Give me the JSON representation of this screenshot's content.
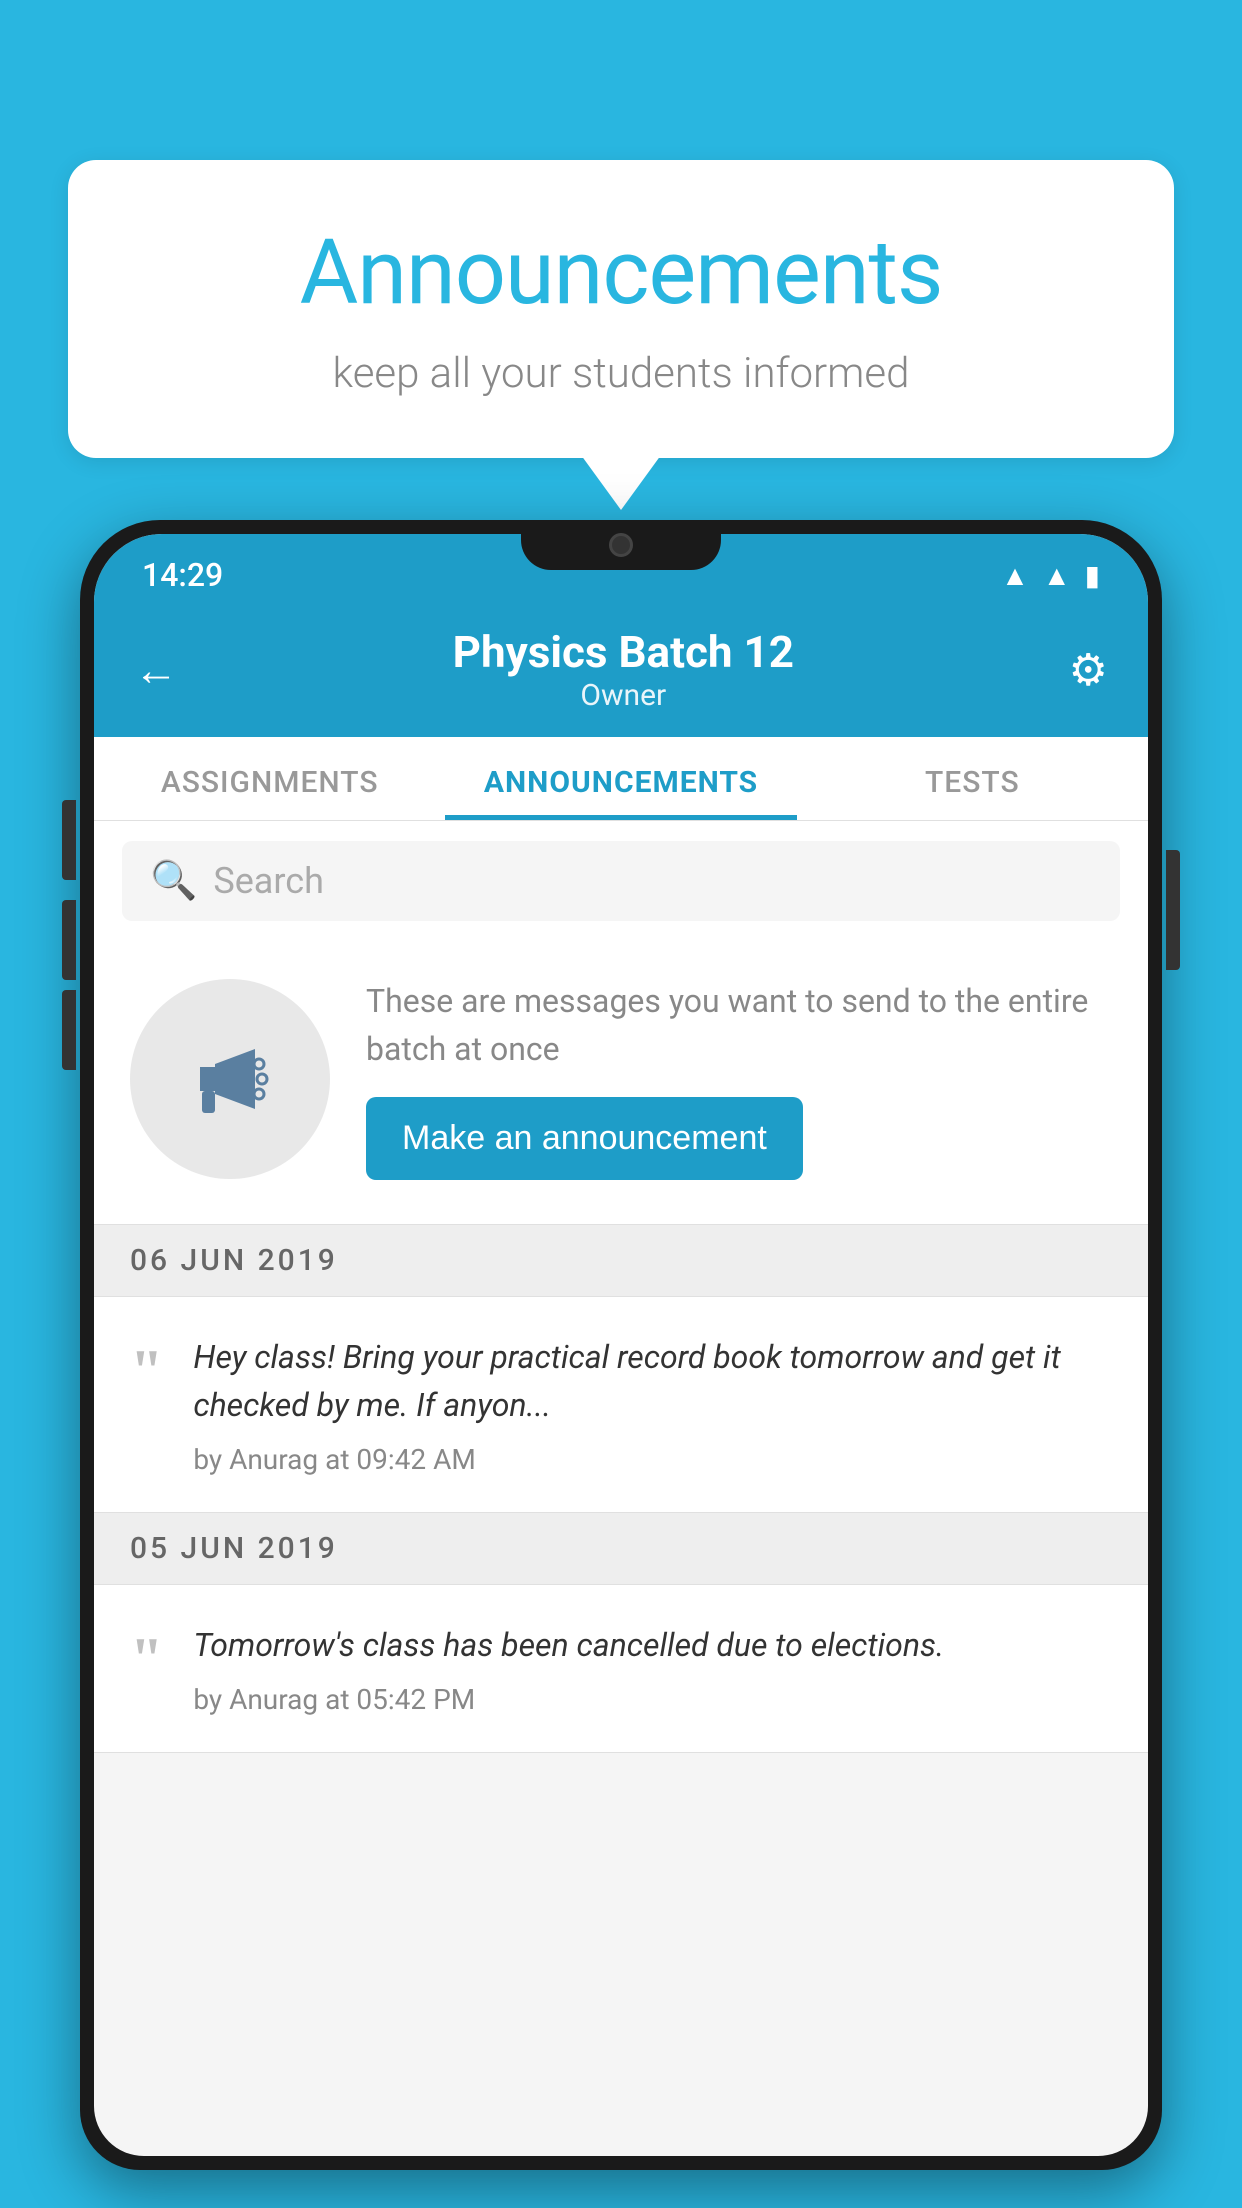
{
  "page": {
    "background_color": "#29b6e0"
  },
  "speech_bubble": {
    "title": "Announcements",
    "subtitle": "keep all your students informed"
  },
  "status_bar": {
    "time": "14:29",
    "wifi_symbol": "▲",
    "signal_symbol": "▲",
    "battery_symbol": "▮"
  },
  "app_header": {
    "back_label": "←",
    "title": "Physics Batch 12",
    "subtitle": "Owner",
    "settings_symbol": "⚙"
  },
  "tabs": [
    {
      "label": "ASSIGNMENTS",
      "active": false
    },
    {
      "label": "ANNOUNCEMENTS",
      "active": true
    },
    {
      "label": "TESTS",
      "active": false
    },
    {
      "label": "...",
      "active": false
    }
  ],
  "search": {
    "placeholder": "Search",
    "icon_symbol": "🔍"
  },
  "promo_card": {
    "description": "These are messages you want to send to the entire batch at once",
    "button_label": "Make an announcement"
  },
  "date_separators": [
    "06  JUN  2019",
    "05  JUN  2019"
  ],
  "announcements": [
    {
      "text": "Hey class! Bring your practical record book tomorrow and get it checked by me. If anyon...",
      "meta": "by Anurag at 09:42 AM",
      "quote": "““"
    },
    {
      "text": "Tomorrow's class has been cancelled due to elections.",
      "meta": "by Anurag at 05:42 PM",
      "quote": "““"
    }
  ]
}
